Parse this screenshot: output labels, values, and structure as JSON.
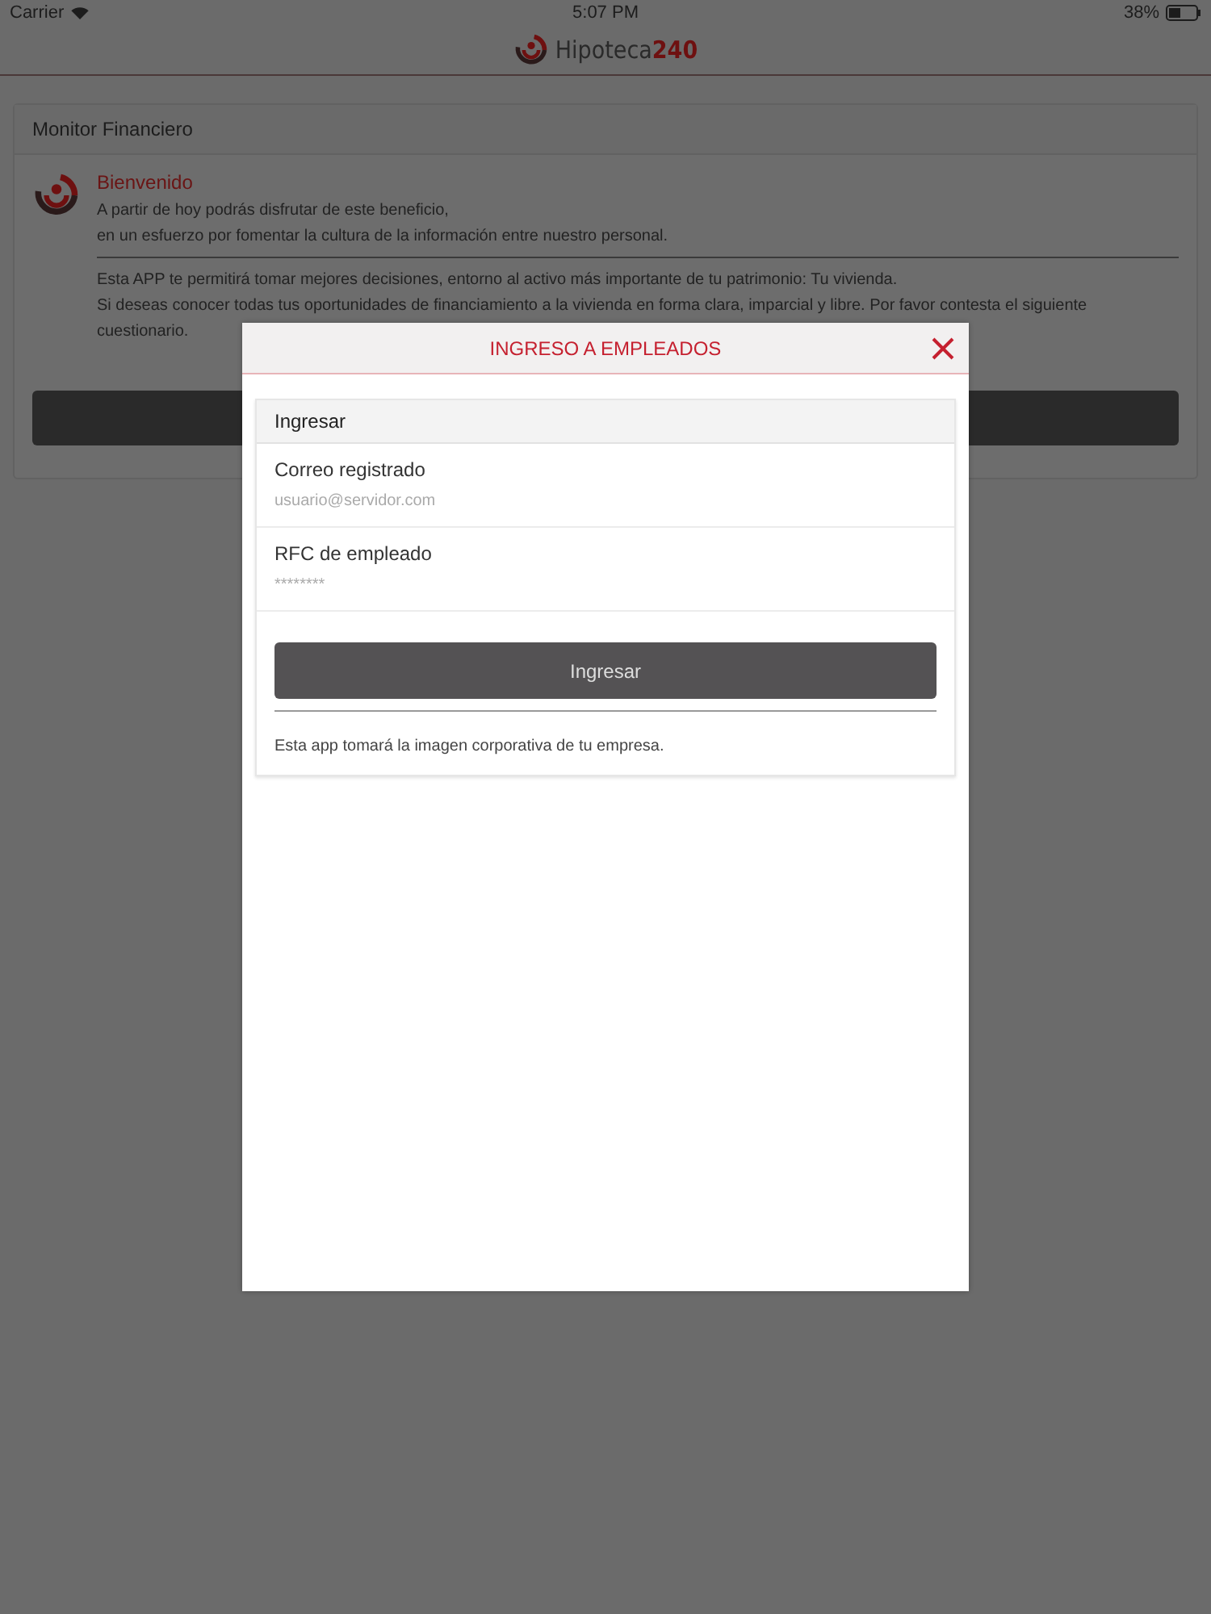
{
  "status_bar": {
    "carrier": "Carrier",
    "time": "5:07 PM",
    "battery": "38%"
  },
  "header": {
    "logo": "Hipoteca**240**"
  },
  "panel": {
    "title": "Monitor Financiero",
    "welcome_title": "Bienvenido",
    "welcome_lines": [
      "A partir de hoy podrás disfrutar de este beneficio,",
      "en un esfuerzo por fomentar la cultura de la información entre nuestro personal."
    ],
    "info_lines": [
      "Esta APP te permitirá tomar mejores decisiones, entorno al activo más importante de tu patrimonio:  Tu vivienda.",
      "Si deseas conocer todas tus oportunidades de financiamiento a la vivienda en forma clara, imparcial y libre. Por favor contesta el siguiente cuestionario."
    ]
  },
  "modal": {
    "title": "INGRESO A EMPLEADOS",
    "section": "Ingresar",
    "fields": [
      {
        "label": "Correo registrado",
        "placeholder": "usuario@servidor.com"
      },
      {
        "label": "RFC de empleado",
        "placeholder": "********"
      }
    ],
    "button": "Ingresar",
    "note": "Esta app tomará la imagen corporativa de tu empresa."
  }
}
